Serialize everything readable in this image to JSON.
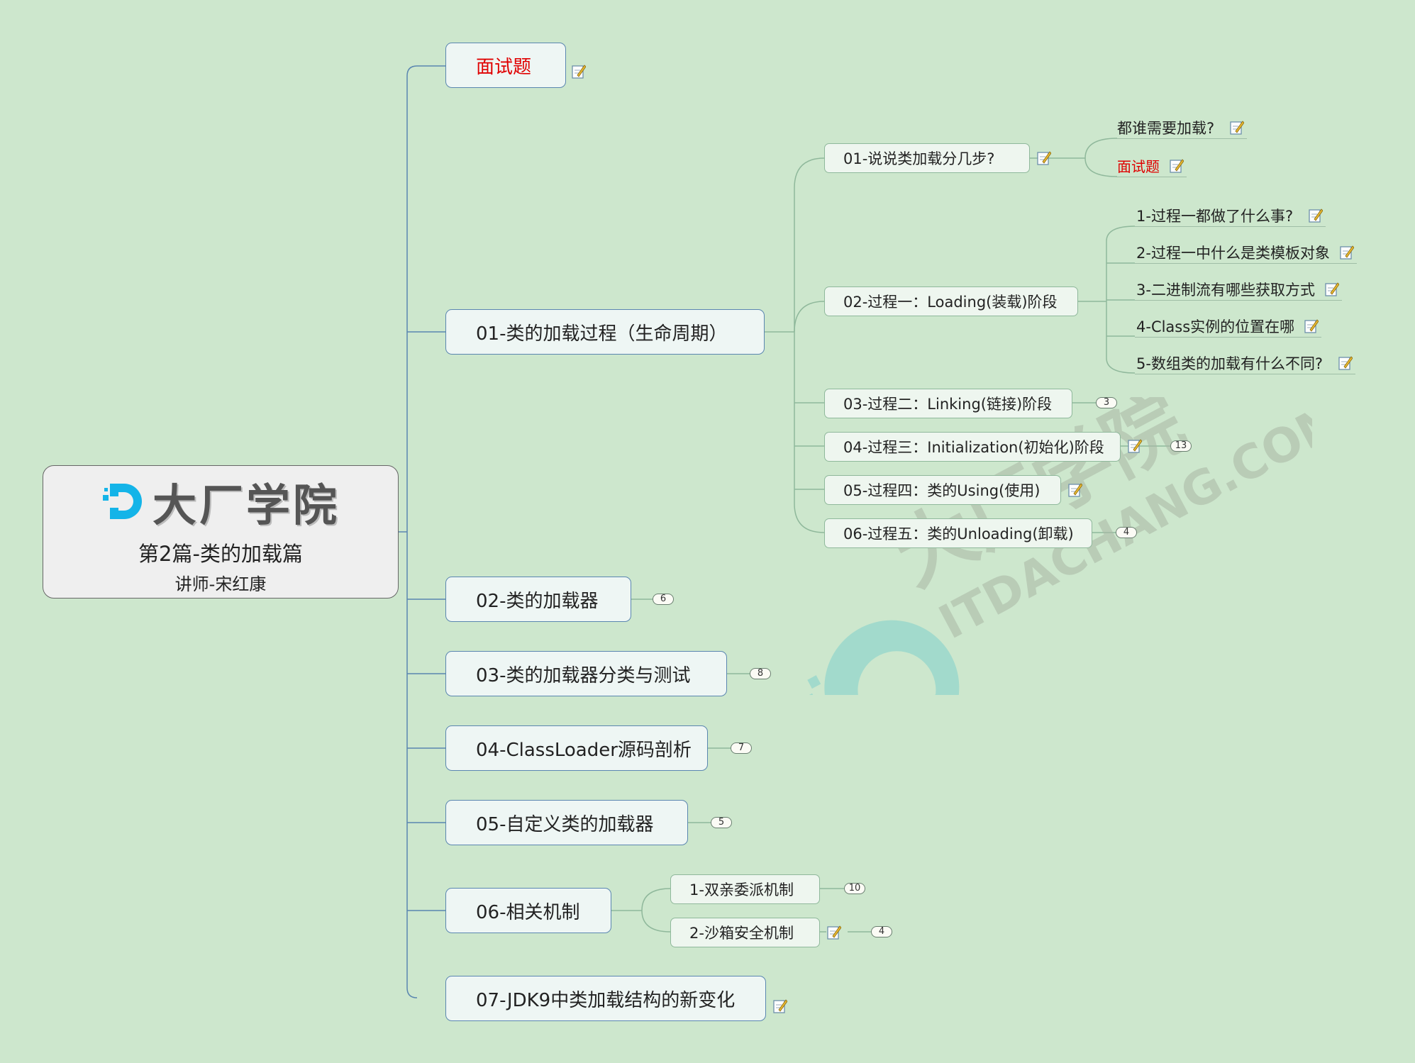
{
  "root": {
    "logo_text": "大厂学院",
    "title": "第2篇-类的加载篇",
    "subtitle": "讲师-宋红康"
  },
  "branches": {
    "b0": "面试题",
    "b1": "01-类的加载过程（生命周期）",
    "b2": "02-类的加载器",
    "b3": "03-类的加载器分类与测试",
    "b4": "04-ClassLoader源码剖析",
    "b5": "05-自定义类的加载器",
    "b6": "06-相关机制",
    "b7": "07-JDK9中类加载结构的新变化"
  },
  "sub": {
    "s1": "01-说说类加载分几步?",
    "s2": "02-过程一：Loading(装载)阶段",
    "s3": "03-过程二：Linking(链接)阶段",
    "s4": "04-过程三：Initialization(初始化)阶段",
    "s5": "05-过程四：类的Using(使用)",
    "s6": "06-过程五：类的Unloading(卸载)",
    "m1": "1-双亲委派机制",
    "m2": "2-沙箱安全机制"
  },
  "leaf": {
    "q1": "都谁需要加载?",
    "q2": "面试题",
    "l1": "1-过程一都做了什么事?",
    "l2": "2-过程一中什么是类模板对象",
    "l3": "3-二进制流有哪些获取方式",
    "l4": "4-Class实例的位置在哪",
    "l5": "5-数组类的加载有什么不同?"
  },
  "badges": {
    "s3": "3",
    "s4": "13",
    "s6": "4",
    "b2": "6",
    "b3": "8",
    "b4": "7",
    "b5": "5",
    "m1": "10",
    "m2": "4"
  },
  "watermark": {
    "cn": "大厂学院",
    "en": "ITDACHANG.COM"
  },
  "colors": {
    "background": "#cde7cd",
    "branch_line": "#5a86b0",
    "sub_line": "#8fb89b",
    "highlight_red": "#e00000",
    "logo_blue": "#14b4e8"
  }
}
